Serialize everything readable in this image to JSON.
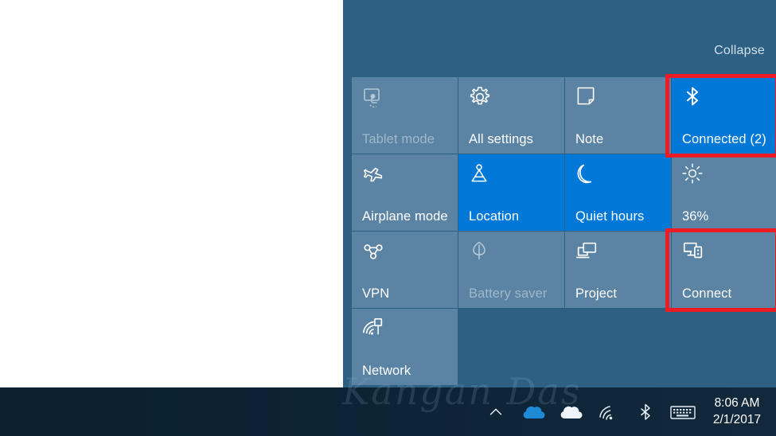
{
  "colors": {
    "panel_bg": "#2e6083",
    "tile_bg": "#5b83a3",
    "tile_active": "#0078d7",
    "highlight_red": "#ed1c24",
    "taskbar_bg": "#0d2234",
    "text": "#ffffff",
    "text_dim": "#9fb8cb"
  },
  "action_center": {
    "collapse_label": "Collapse",
    "tiles": [
      {
        "label": "Tablet mode",
        "icon": "tablet-mode-icon",
        "state": "dim"
      },
      {
        "label": "All settings",
        "icon": "gear-icon",
        "state": "normal"
      },
      {
        "label": "Note",
        "icon": "note-icon",
        "state": "normal"
      },
      {
        "label": "Connected (2)",
        "icon": "bluetooth-icon",
        "state": "active"
      },
      {
        "label": "Airplane mode",
        "icon": "airplane-icon",
        "state": "normal"
      },
      {
        "label": "Location",
        "icon": "location-icon",
        "state": "active"
      },
      {
        "label": "Quiet hours",
        "icon": "moon-icon",
        "state": "active"
      },
      {
        "label": "36%",
        "icon": "brightness-sun-icon",
        "state": "normal"
      },
      {
        "label": "VPN",
        "icon": "vpn-icon",
        "state": "normal"
      },
      {
        "label": "Battery saver",
        "icon": "leaf-icon",
        "state": "dim"
      },
      {
        "label": "Project",
        "icon": "project-screen-icon",
        "state": "normal"
      },
      {
        "label": "Connect",
        "icon": "connect-device-icon",
        "state": "normal"
      },
      {
        "label": "Network",
        "icon": "network-wifi-icon",
        "state": "normal"
      },
      {
        "label": "",
        "icon": "",
        "state": "empty"
      },
      {
        "label": "",
        "icon": "",
        "state": "empty"
      },
      {
        "label": "",
        "icon": "",
        "state": "empty"
      }
    ],
    "highlights": [
      {
        "target": "Connected (2)",
        "name": "highlight-box-connected"
      },
      {
        "target": "Connect",
        "name": "highlight-box-connect"
      }
    ]
  },
  "taskbar": {
    "watermark_text": "Kangan Das",
    "tray_icons": [
      {
        "name": "show-hidden-icons-chevron-icon"
      },
      {
        "name": "onedrive-personal-icon"
      },
      {
        "name": "onedrive-business-icon"
      },
      {
        "name": "network-wifi-tray-icon"
      },
      {
        "name": "bluetooth-tray-icon"
      },
      {
        "name": "touch-keyboard-icon"
      }
    ],
    "clock": {
      "time": "8:06 AM",
      "date": "2/1/2017"
    }
  }
}
